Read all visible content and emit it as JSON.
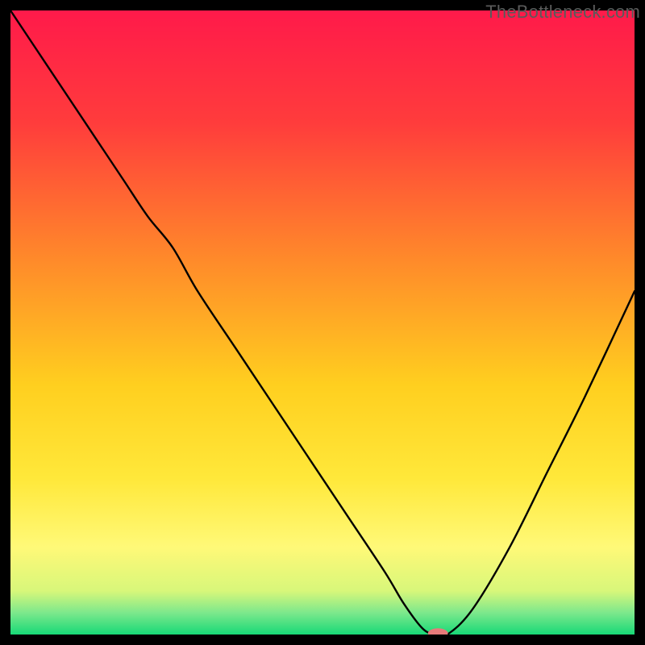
{
  "watermark": "TheBottleneck.com",
  "chart_data": {
    "type": "line",
    "title": "",
    "xlabel": "",
    "ylabel": "",
    "xlim": [
      0,
      100
    ],
    "ylim": [
      0,
      100
    ],
    "grid": false,
    "legend": false,
    "gradient_stops": [
      {
        "offset": 0.0,
        "color": "#ff1a4a"
      },
      {
        "offset": 0.18,
        "color": "#ff3c3c"
      },
      {
        "offset": 0.4,
        "color": "#ff8a2a"
      },
      {
        "offset": 0.6,
        "color": "#ffcf1f"
      },
      {
        "offset": 0.75,
        "color": "#ffe83a"
      },
      {
        "offset": 0.86,
        "color": "#fff978"
      },
      {
        "offset": 0.93,
        "color": "#d8f77a"
      },
      {
        "offset": 0.965,
        "color": "#7de88c"
      },
      {
        "offset": 1.0,
        "color": "#17d977"
      }
    ],
    "series": [
      {
        "name": "bottleneck-curve",
        "x": [
          0,
          6,
          12,
          18,
          22,
          26,
          30,
          36,
          42,
          48,
          54,
          60,
          63,
          66,
          68,
          70,
          74,
          80,
          86,
          92,
          100
        ],
        "y": [
          100,
          91,
          82,
          73,
          67,
          62,
          55,
          46,
          37,
          28,
          19,
          10,
          5,
          1,
          0,
          0,
          4,
          14,
          26,
          38,
          55
        ]
      }
    ],
    "marker": {
      "x": 68.5,
      "y": 0.2,
      "color": "#e77a7a",
      "rx": 1.6,
      "ry": 0.8
    }
  }
}
